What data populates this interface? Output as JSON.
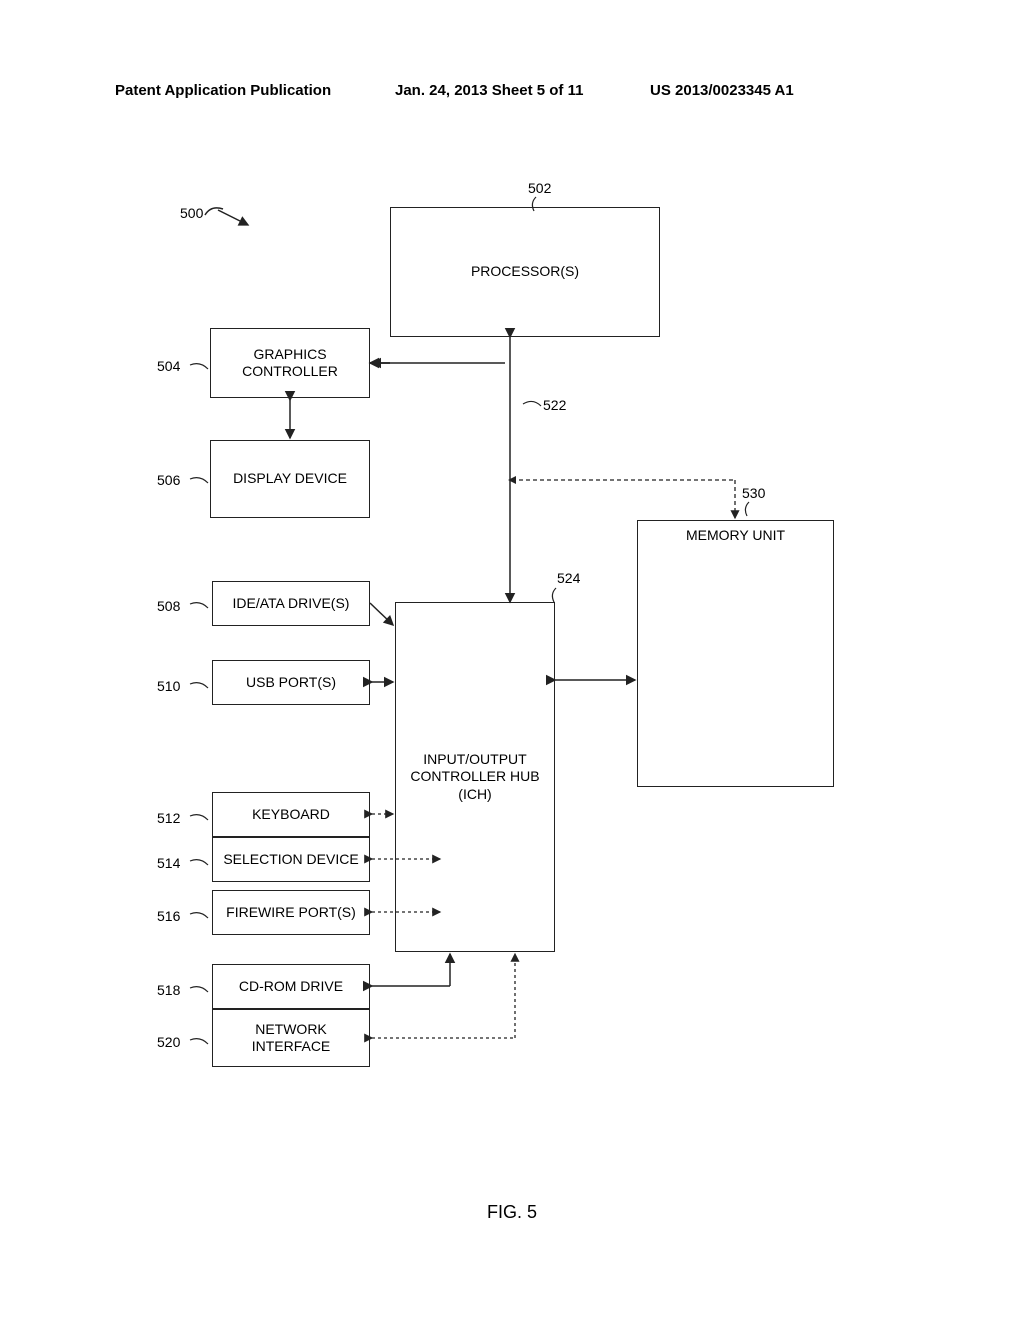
{
  "header": {
    "left": "Patent Application Publication",
    "center": "Jan. 24, 2013  Sheet 5 of 11",
    "right": "US 2013/0023345 A1"
  },
  "figure_label": "FIG. 5",
  "refs": {
    "system": "500",
    "processor": "502",
    "graphics": "504",
    "display": "506",
    "ide": "508",
    "usb": "510",
    "keyboard": "512",
    "selection": "514",
    "firewire": "516",
    "cdrom": "518",
    "network": "520",
    "bus_522": "522",
    "ich": "524",
    "memory": "530"
  },
  "boxes": {
    "processor": "PROCESSOR(S)",
    "graphics": "GRAPHICS CONTROLLER",
    "display": "DISPLAY DEVICE",
    "ide": "IDE/ATA DRIVE(S)",
    "usb": "USB PORT(S)",
    "keyboard": "KEYBOARD",
    "selection": "SELECTION DEVICE",
    "firewire": "FIREWIRE PORT(S)",
    "cdrom": "CD-ROM DRIVE",
    "network": "NETWORK INTERFACE",
    "ich": "INPUT/OUTPUT CONTROLLER HUB (ICH)",
    "memory": "MEMORY UNIT"
  }
}
